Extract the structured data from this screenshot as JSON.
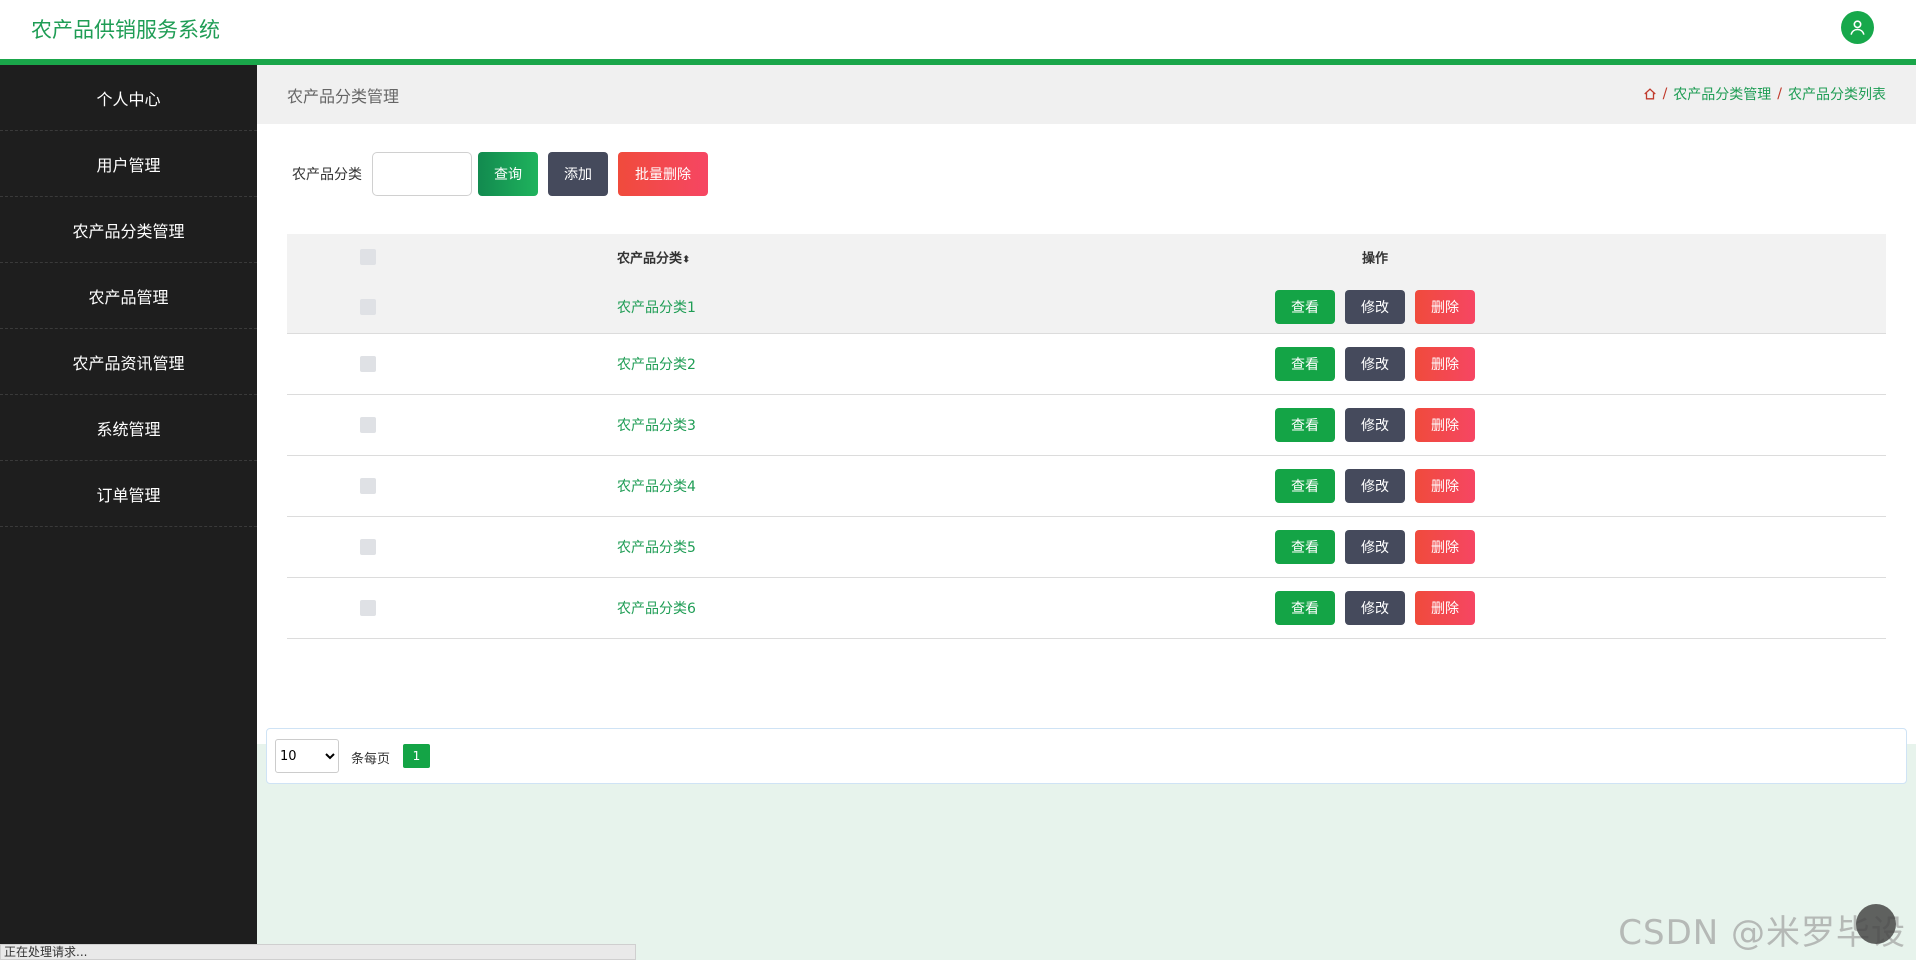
{
  "app": {
    "title": "农产品供销服务系统"
  },
  "sidebar": {
    "items": [
      {
        "label": "个人中心"
      },
      {
        "label": "用户管理"
      },
      {
        "label": "农产品分类管理"
      },
      {
        "label": "农产品管理"
      },
      {
        "label": "农产品资讯管理"
      },
      {
        "label": "系统管理"
      },
      {
        "label": "订单管理"
      }
    ]
  },
  "page": {
    "title": "农产品分类管理",
    "breadcrumb": [
      "农产品分类管理",
      "农产品分类列表"
    ]
  },
  "search": {
    "label": "农产品分类",
    "value": "",
    "query_label": "查询",
    "add_label": "添加",
    "bulk_delete_label": "批量删除"
  },
  "table": {
    "headers": {
      "name": "农产品分类",
      "sort_icon": "⬍",
      "ops": "操作"
    },
    "rows": [
      {
        "name": "农产品分类1"
      },
      {
        "name": "农产品分类2"
      },
      {
        "name": "农产品分类3"
      },
      {
        "name": "农产品分类4"
      },
      {
        "name": "农产品分类5"
      },
      {
        "name": "农产品分类6"
      }
    ],
    "actions": {
      "view": "查看",
      "edit": "修改",
      "delete": "删除"
    }
  },
  "pagination": {
    "page_size": "10",
    "per_page_label": "条每页",
    "current_page": "1"
  },
  "status_bar": "正在处理请求...",
  "watermark": "CSDN @米罗毕设",
  "colors": {
    "accent": "#1aa64a",
    "sidebar_bg": "#1e1e1e",
    "danger": "#f04b3c",
    "dark_button": "#454a5c"
  }
}
